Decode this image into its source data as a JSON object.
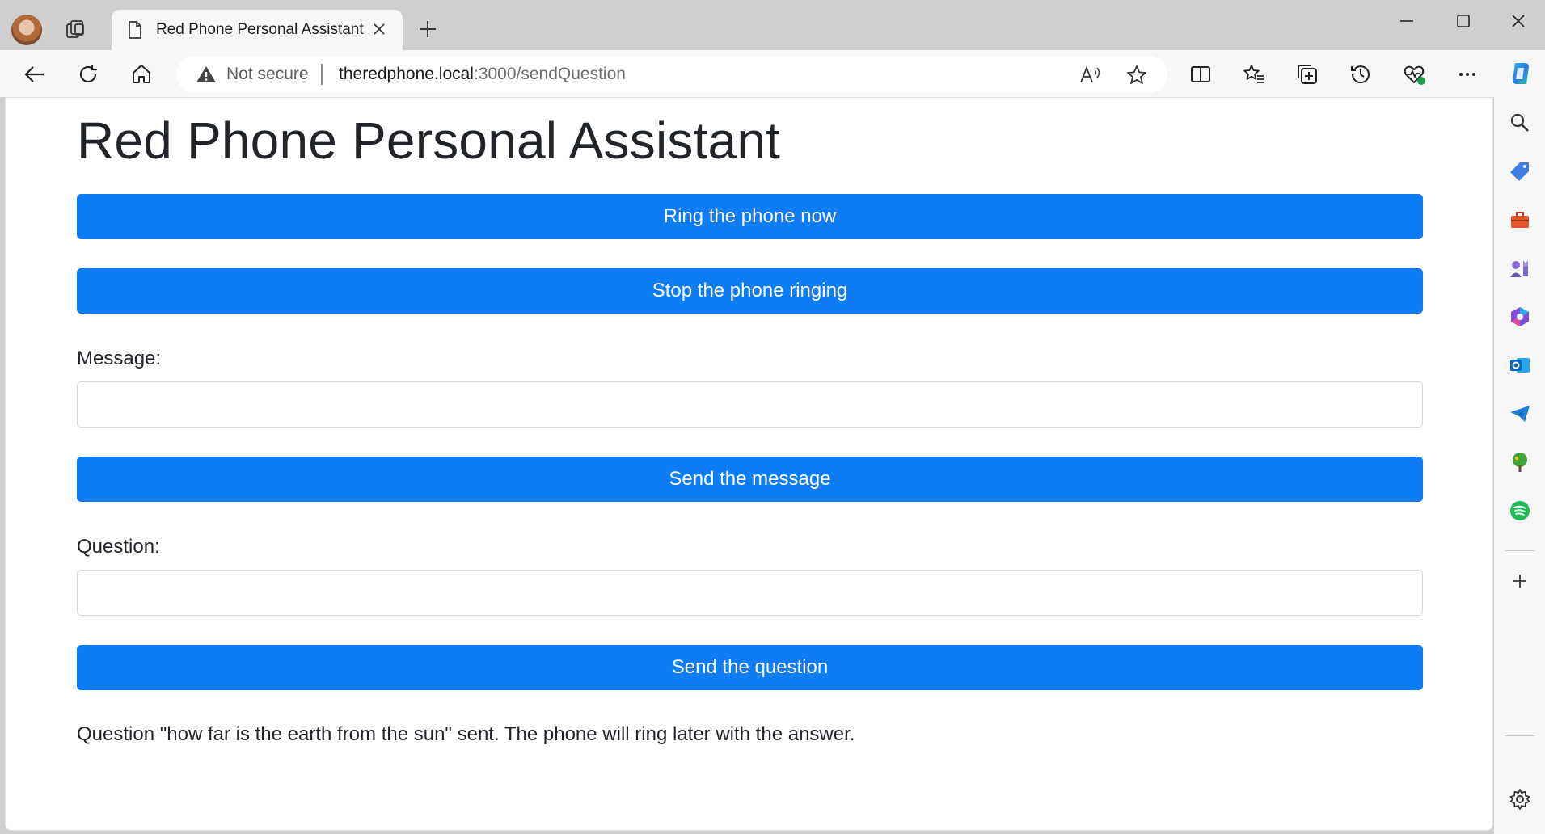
{
  "browser": {
    "tab_title": "Red Phone Personal Assistant",
    "security_label": "Not secure",
    "url_host": "theredphone.local",
    "url_path": ":3000/sendQuestion"
  },
  "page": {
    "title": "Red Phone Personal Assistant",
    "ring_button": "Ring the phone now",
    "stop_button": "Stop the phone ringing",
    "message_label": "Message:",
    "message_value": "",
    "send_message_button": "Send the message",
    "question_label": "Question:",
    "question_value": "",
    "send_question_button": "Send the question",
    "status_text": "Question \"how far is the earth from the sun\" sent. The phone will ring later with the answer."
  },
  "colors": {
    "primary_button": "#0d7cf5",
    "text": "#212529"
  },
  "icons": {
    "toolbar": [
      "back-icon",
      "refresh-icon",
      "home-icon",
      "read-aloud-icon",
      "favorite-star-icon",
      "split-screen-icon",
      "favorites-icon",
      "collections-icon",
      "history-icon",
      "browser-essentials-icon",
      "more-icon",
      "copilot-icon"
    ],
    "sidebar": [
      "search-icon",
      "shopping-icon",
      "tools-icon",
      "games-icon",
      "microsoft365-icon",
      "outlook-icon",
      "telegram-icon",
      "tree-icon",
      "spotify-icon",
      "add-icon",
      "settings-icon"
    ]
  }
}
